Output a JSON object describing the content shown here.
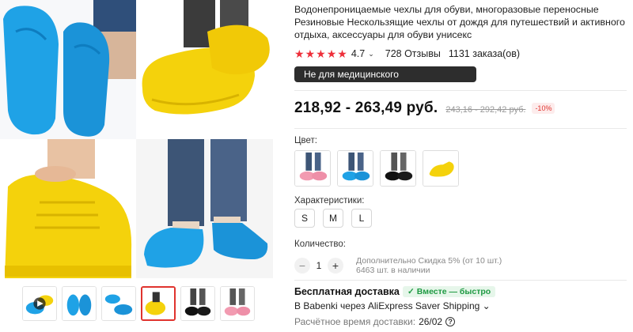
{
  "product": {
    "title": "Водонепроницаемые чехлы для обуви, многоразовые переносные Резиновые Нескользящие чехлы от дождя для путешествий и активного отдыха, аксессуары для обуви унисекс",
    "rating": "4.7",
    "reviews": "728 Отзывы",
    "orders": "1131 заказа(ов)",
    "notice": "Не для медицинского использования"
  },
  "price": {
    "current": "218,92 - 263,49 руб.",
    "old": "243,16 - 292,42 руб.",
    "discount": "-10%"
  },
  "options": {
    "color_label": "Цвет:",
    "colors": [
      "pink",
      "blue",
      "black",
      "yellow"
    ],
    "size_label": "Характеристики:",
    "sizes": [
      "S",
      "M",
      "L"
    ]
  },
  "quantity": {
    "label": "Количество:",
    "value": "1",
    "minus": "−",
    "plus": "+",
    "discount_note": "Дополнительно Скидка 5% (от 10 шт.)",
    "stock": "6463 шт. в наличии"
  },
  "shipping": {
    "title": "Бесплатная доставка",
    "badge": "✓ Вместе — быстро",
    "method": "В Babenki через AliExpress Saver Shipping ⌄",
    "delivery_label": "Расчётное время доставки:",
    "delivery_date": "26/02",
    "help": "?"
  },
  "icons": {
    "star": "★",
    "chevron": "⌄"
  },
  "colors": {
    "accent": "#ee2f3a",
    "blue_shoe": "#1fa2e6",
    "yellow_shoe": "#f4d20c"
  }
}
